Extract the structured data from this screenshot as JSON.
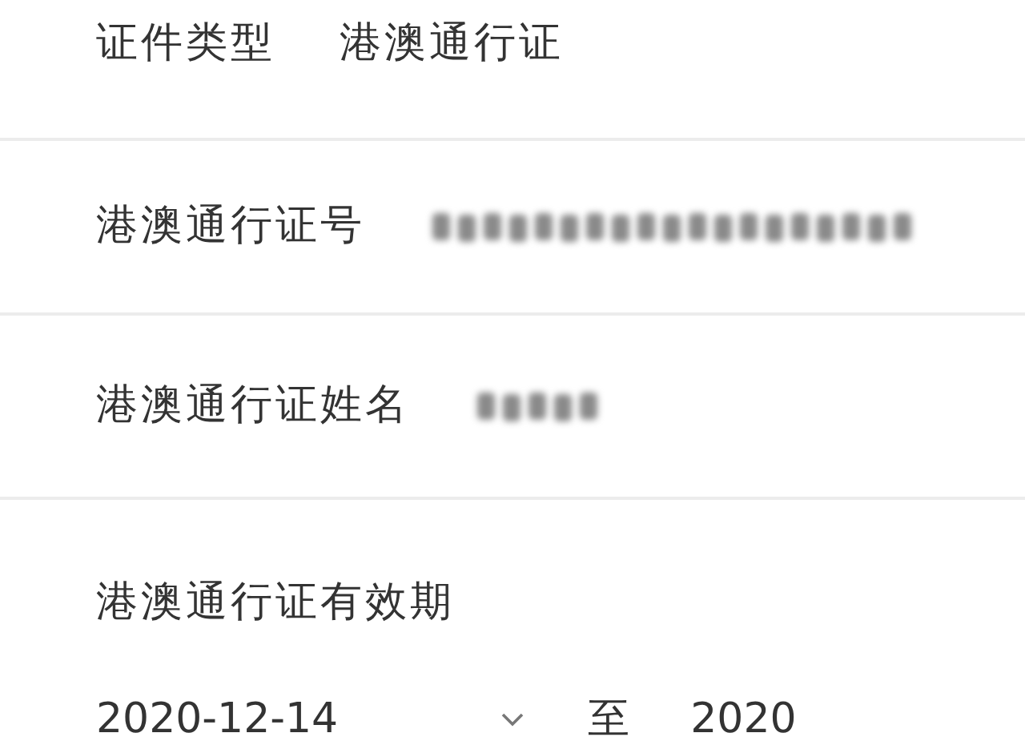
{
  "fields": [
    {
      "label": "证件类型",
      "value": "港澳通行证",
      "kind": "text"
    },
    {
      "label": "港澳通行证号",
      "kind": "blurred"
    },
    {
      "label": "港澳通行证姓名",
      "kind": "blurred"
    }
  ],
  "validity": {
    "label": "港澳通行证有效期",
    "start": "2020-12-14",
    "separator": "至",
    "end": "2020"
  }
}
